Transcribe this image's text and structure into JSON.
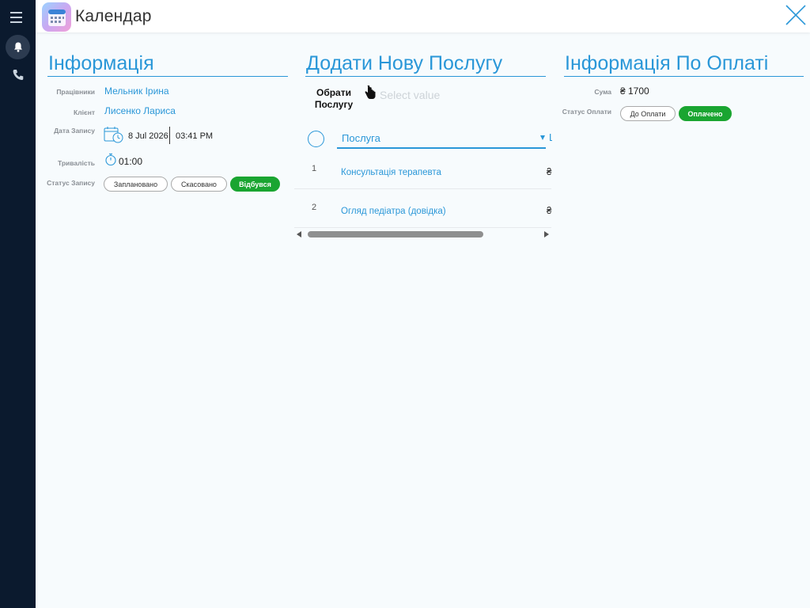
{
  "header": {
    "title": "Календар"
  },
  "info": {
    "title": "Інформація",
    "employee_label": "Працівники",
    "employee": "Мельник Ірина",
    "client_label": "Клієнт",
    "client": "Лисенко Лариса",
    "date_label": "Дата Запису",
    "date": "8 Jul 2026",
    "time": "03:41 PM",
    "duration_label": "Тривалість",
    "duration": "01:00",
    "status_label": "Статус Запису",
    "statuses": [
      "Заплановано",
      "Скасовано",
      "Відбувся"
    ],
    "active_status": "Відбувся"
  },
  "service": {
    "title": "Додати Нову Послугу",
    "select_label": "Обрати Послугу",
    "select_line1": "Обрати",
    "select_line2": "Послугу",
    "select_placeholder": "Select value",
    "column_header": "Послуга",
    "next_column_header_partial": "Ц",
    "rows": [
      {
        "num": "1",
        "name": "Консультація терапевта",
        "price_partial": "₴"
      },
      {
        "num": "2",
        "name": "Огляд педіатра (довідка)",
        "price_partial": "₴"
      }
    ]
  },
  "payment": {
    "title": "Інформація По Оплаті",
    "sum_label": "Сума",
    "sum": "₴ 1700",
    "status_label": "Статус Оплати",
    "statuses": [
      "До Оплати",
      "Оплачено"
    ],
    "active_status": "Оплачено"
  },
  "colors": {
    "accent": "#2a97d8",
    "success": "#1aa531",
    "rail": "#0b1a2e"
  }
}
